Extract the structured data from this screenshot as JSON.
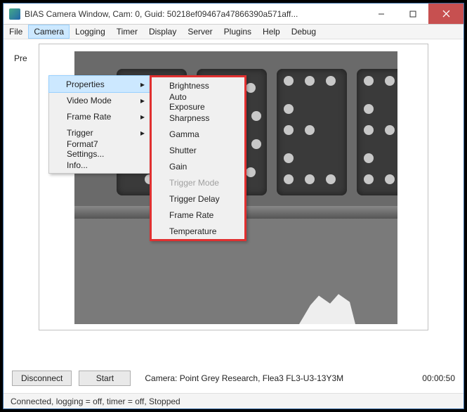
{
  "window": {
    "title": "BIAS Camera Window, Cam: 0, Guid: 50218ef09467a47866390a571aff..."
  },
  "menubar": {
    "items": [
      "File",
      "Camera",
      "Logging",
      "Timer",
      "Display",
      "Server",
      "Plugins",
      "Help",
      "Debug"
    ],
    "active_index": 1
  },
  "camera_menu": {
    "items": [
      {
        "label": "Properties",
        "submenu": true,
        "highlighted": true
      },
      {
        "label": "Video Mode",
        "submenu": true
      },
      {
        "label": "Frame Rate",
        "submenu": true
      },
      {
        "label": "Trigger",
        "submenu": true
      },
      {
        "label": "Format7 Settings..."
      },
      {
        "label": "Info..."
      }
    ]
  },
  "properties_submenu": {
    "items": [
      {
        "label": "Brightness"
      },
      {
        "label": "Auto Exposure"
      },
      {
        "label": "Sharpness"
      },
      {
        "label": "Gamma"
      },
      {
        "label": "Shutter"
      },
      {
        "label": "Gain"
      },
      {
        "label": "Trigger Mode",
        "disabled": true
      },
      {
        "label": "Trigger Delay"
      },
      {
        "label": "Frame Rate"
      },
      {
        "label": "Temperature"
      }
    ]
  },
  "preview": {
    "label": "Pre"
  },
  "controls": {
    "disconnect": "Disconnect",
    "start": "Start",
    "camera_info": "Camera:  Point Grey Research,  Flea3 FL3-U3-13Y3M",
    "timecode": "00:00:50"
  },
  "status": "Connected, logging = off, timer = off, Stopped",
  "colors": {
    "highlight": "#cce8ff",
    "close": "#c75050",
    "submenu_border": "#e03030"
  }
}
